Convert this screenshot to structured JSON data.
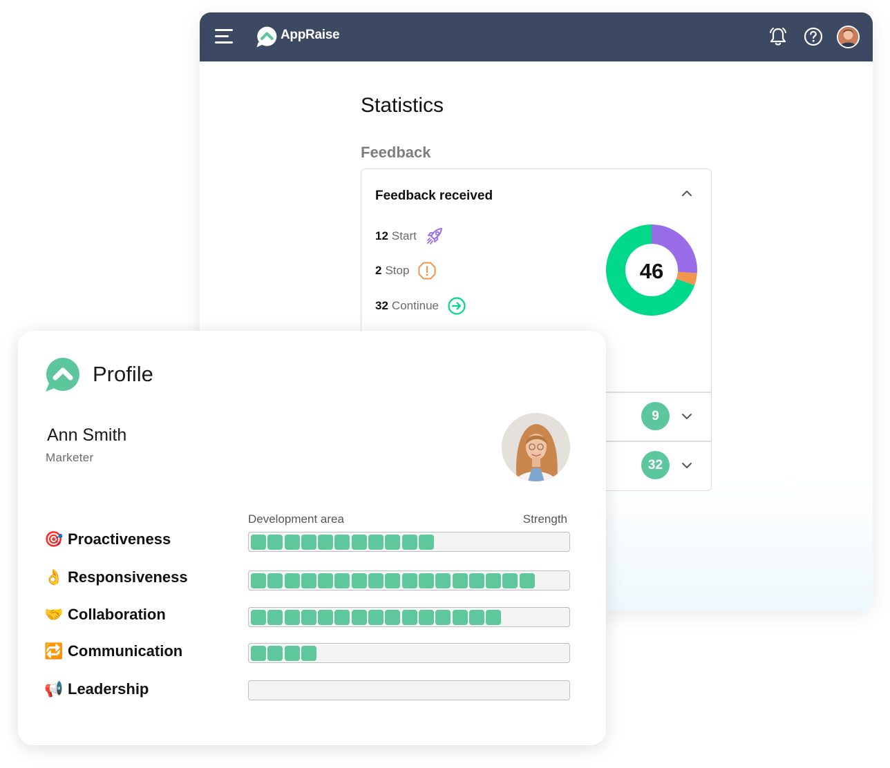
{
  "app": {
    "brand": "AppRaise",
    "page_title": "Statistics",
    "section_heading": "Feedback",
    "accent_color": "#5cc79d",
    "topbar_color": "#3d4963",
    "icons": [
      "menu-icon",
      "bell-icon",
      "help-icon",
      "user-avatar"
    ]
  },
  "feedback_card": {
    "title": "Feedback received",
    "items": [
      {
        "count": "12",
        "label": "Start",
        "icon": "rocket-icon",
        "color": "#9a6de8"
      },
      {
        "count": "2",
        "label": "Stop",
        "icon": "alert-icon",
        "color": "#f0964d"
      },
      {
        "count": "32",
        "label": "Continue",
        "icon": "arrow-right-circle-icon",
        "color": "#00d98a"
      }
    ],
    "total": "46",
    "collapsed_rows": [
      {
        "count": "9"
      },
      {
        "count": "32"
      }
    ]
  },
  "chart_data": {
    "type": "pie",
    "categories": [
      "Start",
      "Stop",
      "Continue"
    ],
    "values": [
      12,
      2,
      32
    ],
    "colors": [
      "#9a6de8",
      "#f0964d",
      "#00d98a"
    ],
    "center_label": "46"
  },
  "profile": {
    "title": "Profile",
    "name": "Ann Smith",
    "role": "Marketer",
    "scale_left": "Development area",
    "scale_right": "Strength",
    "skills": [
      {
        "name": "Proactiveness",
        "emoji": "🎯",
        "level": 11
      },
      {
        "name": "Responsiveness",
        "emoji": "👌",
        "level": 17
      },
      {
        "name": "Collaboration",
        "emoji": "🤝",
        "level": 15
      },
      {
        "name": "Communication",
        "emoji": "🔁",
        "level": 4
      },
      {
        "name": "Leadership",
        "emoji": "📢",
        "level": 0
      }
    ],
    "max_level": 19
  }
}
